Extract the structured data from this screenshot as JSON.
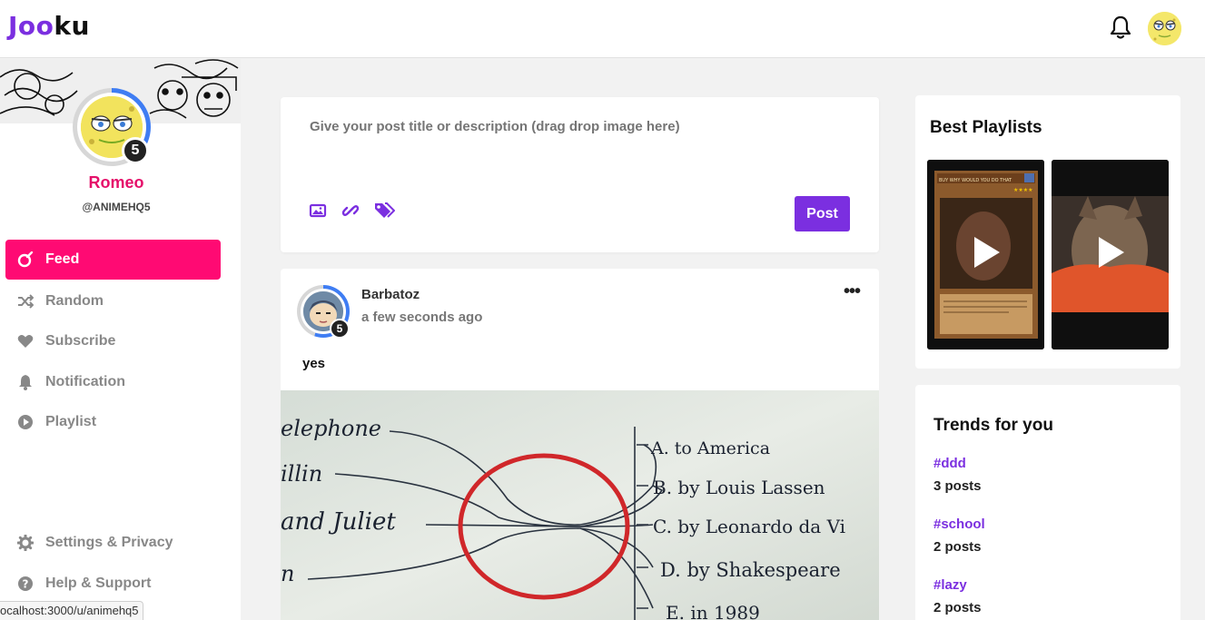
{
  "app": {
    "logo_part1": "Joo",
    "logo_part2": "ku",
    "accent_color": "#7b2fe0",
    "active_color": "#ff0a73"
  },
  "header": {
    "notification_icon": "bell-icon",
    "avatar_icon": "user-avatar"
  },
  "profile": {
    "name": "Romeo",
    "handle": "@ANIMEHQ5",
    "level": "5"
  },
  "sidebar": {
    "items": [
      {
        "label": "Feed",
        "icon": "feed-icon"
      },
      {
        "label": "Random",
        "icon": "shuffle-icon"
      },
      {
        "label": "Subscribe",
        "icon": "heart-icon"
      },
      {
        "label": "Notification",
        "icon": "bell-icon"
      },
      {
        "label": "Playlist",
        "icon": "play-circle-icon"
      }
    ],
    "footer_items": [
      {
        "label": "Settings & Privacy",
        "icon": "gear-icon"
      },
      {
        "label": "Help & Support",
        "icon": "question-icon"
      }
    ]
  },
  "composer": {
    "placeholder": "Give your post title or description (drag drop image here)",
    "post_label": "Post"
  },
  "post": {
    "author": "Barbatoz",
    "time": "a few seconds ago",
    "text": "yes",
    "level": "5",
    "menu": "•••",
    "image_lines": {
      "left": [
        "elephone",
        "illin",
        "and Juliet",
        "n"
      ],
      "right": [
        "A. to America",
        "B. by Louis Lassen",
        "C. by Leonardo da Vi",
        "D. by Shakespeare",
        "E. in 1989"
      ]
    }
  },
  "best_playlists": {
    "title": "Best Playlists",
    "card_title": "BUY WHY WOULD YOU DO THAT"
  },
  "trends": {
    "title": "Trends for you",
    "items": [
      {
        "tag": "#ddd",
        "count": "3 posts"
      },
      {
        "tag": "#school",
        "count": "2 posts"
      },
      {
        "tag": "#lazy",
        "count": "2 posts"
      }
    ]
  },
  "status_bar": {
    "url": "ocalhost:3000/u/animehq5"
  }
}
